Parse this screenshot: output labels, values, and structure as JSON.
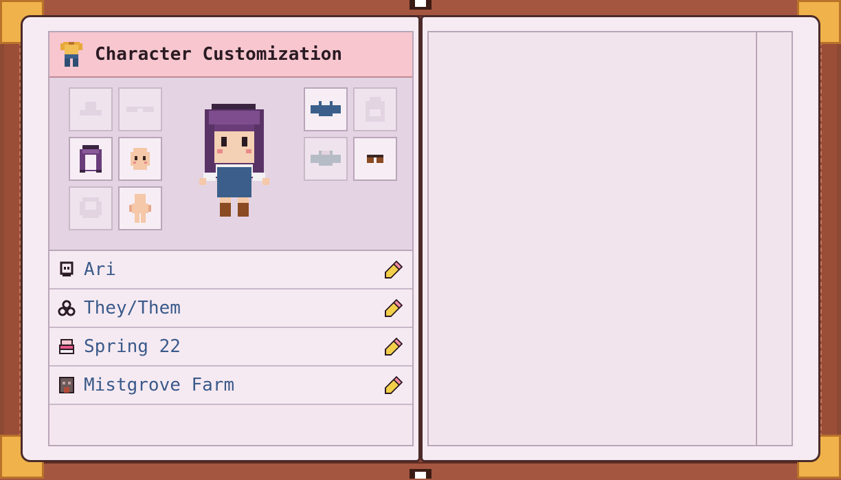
{
  "header": {
    "title": "Character Customization",
    "title_icon": "shirt-pants-icon"
  },
  "slots_left": [
    {
      "name": "hat",
      "icon": "hat-icon",
      "equipped": false
    },
    {
      "name": "glasses",
      "icon": "glasses-icon",
      "equipped": false
    },
    {
      "name": "hair",
      "icon": "hair-icon",
      "equipped": true
    },
    {
      "name": "face",
      "icon": "face-icon",
      "equipped": true
    },
    {
      "name": "beard",
      "icon": "beard-icon",
      "equipped": false
    },
    {
      "name": "body",
      "icon": "body-icon",
      "equipped": true
    }
  ],
  "slots_right": [
    {
      "name": "top",
      "icon": "shirt-icon",
      "equipped": true
    },
    {
      "name": "backpack",
      "icon": "backpack-icon",
      "equipped": false
    },
    {
      "name": "outer-top",
      "icon": "jacket-icon",
      "equipped": false
    },
    {
      "name": "shoes",
      "icon": "shoes-icon",
      "equipped": true
    }
  ],
  "fields": [
    {
      "key": "name",
      "icon": "person-icon",
      "value": "Ari"
    },
    {
      "key": "pronouns",
      "icon": "pronouns-icon",
      "value": "They/Them"
    },
    {
      "key": "birthday",
      "icon": "cake-icon",
      "value": "Spring 22"
    },
    {
      "key": "farm",
      "icon": "barn-icon",
      "value": "Mistgrove Farm"
    }
  ],
  "colors": {
    "title_bg": "#f7c6cf",
    "field_text": "#3a5a8a",
    "cover": "#8c4a34",
    "corner": "#f0b24a"
  }
}
